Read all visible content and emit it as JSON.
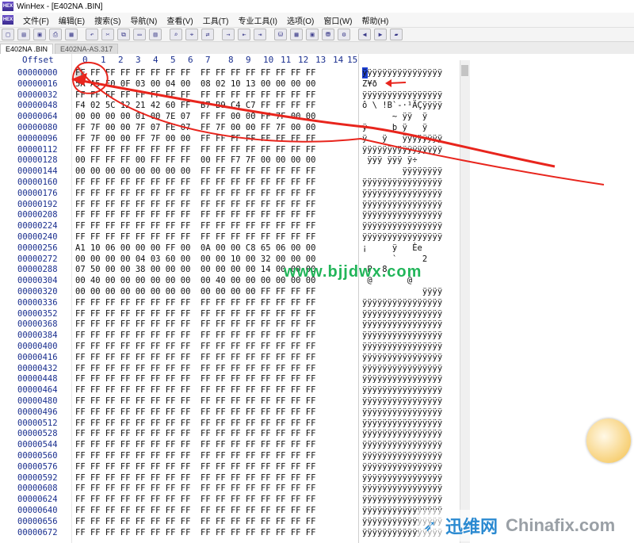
{
  "window": {
    "title": "WinHex - [E402NA .BIN]"
  },
  "menu": [
    {
      "label": "文件(F)"
    },
    {
      "label": "编辑(E)"
    },
    {
      "label": "搜索(S)"
    },
    {
      "label": "导航(N)"
    },
    {
      "label": "查看(V)"
    },
    {
      "label": "工具(T)"
    },
    {
      "label": "专业工具(I)"
    },
    {
      "label": "选项(O)"
    },
    {
      "label": "窗口(W)"
    },
    {
      "label": "帮助(H)"
    }
  ],
  "toolbar_icons": [
    "new-file-icon",
    "open-icon",
    "save-icon",
    "print-icon",
    "properties-icon",
    "undo-icon",
    "cut-icon",
    "copy-icon",
    "paste-icon",
    "paste-special-icon",
    "find-icon",
    "find-hex-icon",
    "replace-icon",
    "goto-icon",
    "back-icon",
    "forward-icon",
    "disk-icon",
    "ram-icon",
    "calc-icon",
    "drive-icon",
    "settings-icon",
    "prev-icon",
    "next-icon",
    "book-icon"
  ],
  "tabs": [
    {
      "label": "E402NA .BIN",
      "active": true
    },
    {
      "label": "E402NA-AS.317",
      "active": false
    }
  ],
  "columns": {
    "offset_label": "Offset",
    "bytes": [
      "0",
      "1",
      "2",
      "3",
      "4",
      "5",
      "6",
      "7",
      "8",
      "9",
      "10",
      "11",
      "12",
      "13",
      "14",
      "15"
    ]
  },
  "rows": [
    {
      "offset": "00000000",
      "hex": "FF FF FF FF FF FF FF FF  FF FF FF FF FF FF FF FF",
      "ascii": "ÿÿÿÿÿÿÿÿÿÿÿÿÿÿÿÿ"
    },
    {
      "offset": "00000016",
      "hex": "5A A5 F0 0F 03 00 04 00  08 02 10 13 00 00 00 00",
      "ascii": "Z¥ð"
    },
    {
      "offset": "00000032",
      "hex": "FF FF FF FF FF FF FF FF  FF FF FF FF FF FF FF FF",
      "ascii": "ÿÿÿÿÿÿÿÿÿÿÿÿÿÿÿÿ"
    },
    {
      "offset": "00000048",
      "hex": "F4 02 5C 12 21 42 60 FF  B7 B9 C4 C7 FF FF FF FF",
      "ascii": "ô \\ !B`-·¹ÄÇÿÿÿÿ"
    },
    {
      "offset": "00000064",
      "hex": "00 00 00 00 01 00 7E 07  FF FF 00 00 FF 7F 00 00",
      "ascii": "      ~ ÿÿ  ÿ"
    },
    {
      "offset": "00000080",
      "hex": "FF 7F 00 00 7F 07 FE 07  FF 7F 00 00 FF 7F 00 00",
      "ascii": "ÿ     þ ÿ   ÿ"
    },
    {
      "offset": "00000096",
      "hex": "FF 7F 00 00 FF 7F 00 00  FF FF FF FF FF FF FF FF",
      "ascii": "ÿ   ÿ   ÿÿÿÿÿÿÿÿ"
    },
    {
      "offset": "00000112",
      "hex": "FF FF FF FF FF FF FF FF  FF FF FF FF FF FF FF FF",
      "ascii": "ÿÿÿÿÿÿÿÿÿÿÿÿÿÿÿÿ"
    },
    {
      "offset": "00000128",
      "hex": "00 FF FF FF 00 FF FF FF  00 FF F7 7F 00 00 00 00",
      "ascii": " ÿÿÿ ÿÿÿ ÿ÷"
    },
    {
      "offset": "00000144",
      "hex": "00 00 00 00 00 00 00 00  FF FF FF FF FF FF FF FF",
      "ascii": "        ÿÿÿÿÿÿÿÿ"
    },
    {
      "offset": "00000160",
      "hex": "FF FF FF FF FF FF FF FF  FF FF FF FF FF FF FF FF",
      "ascii": "ÿÿÿÿÿÿÿÿÿÿÿÿÿÿÿÿ"
    },
    {
      "offset": "00000176",
      "hex": "FF FF FF FF FF FF FF FF  FF FF FF FF FF FF FF FF",
      "ascii": "ÿÿÿÿÿÿÿÿÿÿÿÿÿÿÿÿ"
    },
    {
      "offset": "00000192",
      "hex": "FF FF FF FF FF FF FF FF  FF FF FF FF FF FF FF FF",
      "ascii": "ÿÿÿÿÿÿÿÿÿÿÿÿÿÿÿÿ"
    },
    {
      "offset": "00000208",
      "hex": "FF FF FF FF FF FF FF FF  FF FF FF FF FF FF FF FF",
      "ascii": "ÿÿÿÿÿÿÿÿÿÿÿÿÿÿÿÿ"
    },
    {
      "offset": "00000224",
      "hex": "FF FF FF FF FF FF FF FF  FF FF FF FF FF FF FF FF",
      "ascii": "ÿÿÿÿÿÿÿÿÿÿÿÿÿÿÿÿ"
    },
    {
      "offset": "00000240",
      "hex": "FF FF FF FF FF FF FF FF  FF FF FF FF FF FF FF FF",
      "ascii": "ÿÿÿÿÿÿÿÿÿÿÿÿÿÿÿÿ"
    },
    {
      "offset": "00000256",
      "hex": "A1 10 06 00 00 00 FF 00  0A 00 00 C8 65 06 00 00",
      "ascii": "¡     ÿ   Èe"
    },
    {
      "offset": "00000272",
      "hex": "00 00 00 00 04 03 60 00  00 00 10 00 32 00 00 00",
      "ascii": "      `     2"
    },
    {
      "offset": "00000288",
      "hex": "07 50 00 00 38 00 00 00  00 00 00 00 14 00 00 00",
      "ascii": " P  8"
    },
    {
      "offset": "00000304",
      "hex": "00 40 00 00 00 00 00 00  00 40 00 00 00 00 00 00",
      "ascii": " @       @"
    },
    {
      "offset": "00000320",
      "hex": "00 00 00 00 00 00 00 00  00 00 00 00 FF FF FF FF",
      "ascii": "            ÿÿÿÿ"
    },
    {
      "offset": "00000336",
      "hex": "FF FF FF FF FF FF FF FF  FF FF FF FF FF FF FF FF",
      "ascii": "ÿÿÿÿÿÿÿÿÿÿÿÿÿÿÿÿ"
    },
    {
      "offset": "00000352",
      "hex": "FF FF FF FF FF FF FF FF  FF FF FF FF FF FF FF FF",
      "ascii": "ÿÿÿÿÿÿÿÿÿÿÿÿÿÿÿÿ"
    },
    {
      "offset": "00000368",
      "hex": "FF FF FF FF FF FF FF FF  FF FF FF FF FF FF FF FF",
      "ascii": "ÿÿÿÿÿÿÿÿÿÿÿÿÿÿÿÿ"
    },
    {
      "offset": "00000384",
      "hex": "FF FF FF FF FF FF FF FF  FF FF FF FF FF FF FF FF",
      "ascii": "ÿÿÿÿÿÿÿÿÿÿÿÿÿÿÿÿ"
    },
    {
      "offset": "00000400",
      "hex": "FF FF FF FF FF FF FF FF  FF FF FF FF FF FF FF FF",
      "ascii": "ÿÿÿÿÿÿÿÿÿÿÿÿÿÿÿÿ"
    },
    {
      "offset": "00000416",
      "hex": "FF FF FF FF FF FF FF FF  FF FF FF FF FF FF FF FF",
      "ascii": "ÿÿÿÿÿÿÿÿÿÿÿÿÿÿÿÿ"
    },
    {
      "offset": "00000432",
      "hex": "FF FF FF FF FF FF FF FF  FF FF FF FF FF FF FF FF",
      "ascii": "ÿÿÿÿÿÿÿÿÿÿÿÿÿÿÿÿ"
    },
    {
      "offset": "00000448",
      "hex": "FF FF FF FF FF FF FF FF  FF FF FF FF FF FF FF FF",
      "ascii": "ÿÿÿÿÿÿÿÿÿÿÿÿÿÿÿÿ"
    },
    {
      "offset": "00000464",
      "hex": "FF FF FF FF FF FF FF FF  FF FF FF FF FF FF FF FF",
      "ascii": "ÿÿÿÿÿÿÿÿÿÿÿÿÿÿÿÿ"
    },
    {
      "offset": "00000480",
      "hex": "FF FF FF FF FF FF FF FF  FF FF FF FF FF FF FF FF",
      "ascii": "ÿÿÿÿÿÿÿÿÿÿÿÿÿÿÿÿ"
    },
    {
      "offset": "00000496",
      "hex": "FF FF FF FF FF FF FF FF  FF FF FF FF FF FF FF FF",
      "ascii": "ÿÿÿÿÿÿÿÿÿÿÿÿÿÿÿÿ"
    },
    {
      "offset": "00000512",
      "hex": "FF FF FF FF FF FF FF FF  FF FF FF FF FF FF FF FF",
      "ascii": "ÿÿÿÿÿÿÿÿÿÿÿÿÿÿÿÿ"
    },
    {
      "offset": "00000528",
      "hex": "FF FF FF FF FF FF FF FF  FF FF FF FF FF FF FF FF",
      "ascii": "ÿÿÿÿÿÿÿÿÿÿÿÿÿÿÿÿ"
    },
    {
      "offset": "00000544",
      "hex": "FF FF FF FF FF FF FF FF  FF FF FF FF FF FF FF FF",
      "ascii": "ÿÿÿÿÿÿÿÿÿÿÿÿÿÿÿÿ"
    },
    {
      "offset": "00000560",
      "hex": "FF FF FF FF FF FF FF FF  FF FF FF FF FF FF FF FF",
      "ascii": "ÿÿÿÿÿÿÿÿÿÿÿÿÿÿÿÿ"
    },
    {
      "offset": "00000576",
      "hex": "FF FF FF FF FF FF FF FF  FF FF FF FF FF FF FF FF",
      "ascii": "ÿÿÿÿÿÿÿÿÿÿÿÿÿÿÿÿ"
    },
    {
      "offset": "00000592",
      "hex": "FF FF FF FF FF FF FF FF  FF FF FF FF FF FF FF FF",
      "ascii": "ÿÿÿÿÿÿÿÿÿÿÿÿÿÿÿÿ"
    },
    {
      "offset": "00000608",
      "hex": "FF FF FF FF FF FF FF FF  FF FF FF FF FF FF FF FF",
      "ascii": "ÿÿÿÿÿÿÿÿÿÿÿÿÿÿÿÿ"
    },
    {
      "offset": "00000624",
      "hex": "FF FF FF FF FF FF FF FF  FF FF FF FF FF FF FF FF",
      "ascii": "ÿÿÿÿÿÿÿÿÿÿÿÿÿÿÿÿ"
    },
    {
      "offset": "00000640",
      "hex": "FF FF FF FF FF FF FF FF  FF FF FF FF FF FF FF FF",
      "ascii": "ÿÿÿÿÿÿÿÿÿÿÿÿÿÿÿÿ"
    },
    {
      "offset": "00000656",
      "hex": "FF FF FF FF FF FF FF FF  FF FF FF FF FF FF FF FF",
      "ascii": "ÿÿÿÿÿÿÿÿÿÿÿÿÿÿÿÿ"
    },
    {
      "offset": "00000672",
      "hex": "FF FF FF FF FF FF FF FF  FF FF FF FF FF FF FF FF",
      "ascii": "ÿÿÿÿÿÿÿÿÿÿÿÿÿÿÿÿ"
    }
  ],
  "watermark": "www.bjjdwx.com",
  "brand": {
    "cn": "迅维网",
    "en": "Chinafix.com"
  },
  "colors": {
    "offset": "#1a2f8f",
    "cursor": "#1b3fd1",
    "annotation": "#e8251d",
    "watermark": "#22b55a"
  }
}
